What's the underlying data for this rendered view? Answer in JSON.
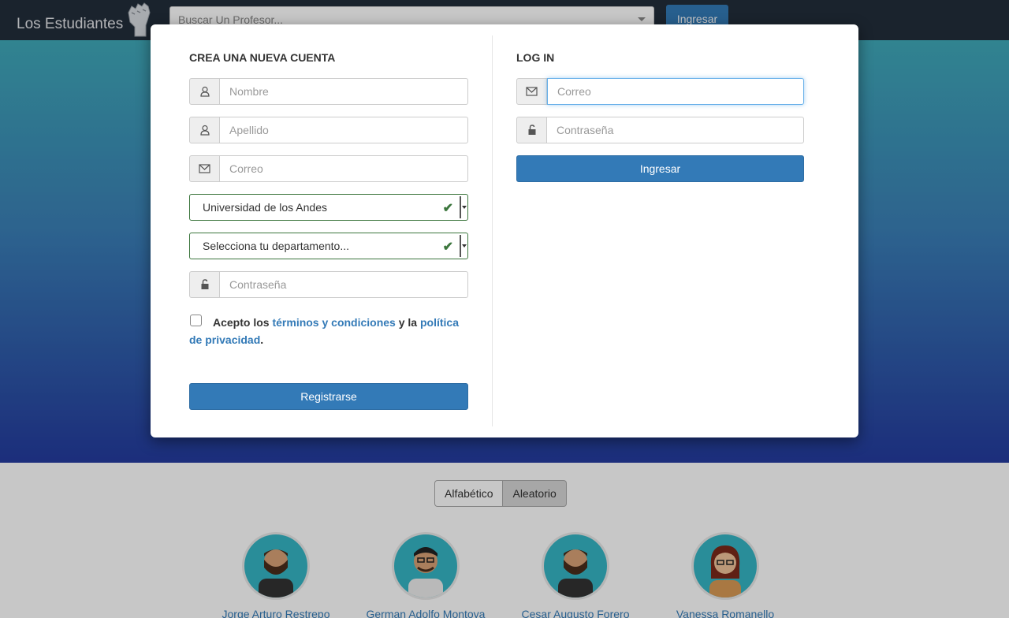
{
  "navbar": {
    "brand": "Los Estudiantes",
    "search_placeholder": "Buscar Un Profesor...",
    "login_button": "Ingresar"
  },
  "sort": {
    "options": [
      "Alfabético",
      "Aleatorio"
    ],
    "selected": "Aleatorio"
  },
  "professors": [
    {
      "name": "Jorge Arturo Restrepo"
    },
    {
      "name": "German Adolfo Montoya"
    },
    {
      "name": "Cesar Augusto Forero"
    },
    {
      "name": "Vanessa Romanello"
    }
  ],
  "signup": {
    "title": "CREA UNA NUEVA CUENTA",
    "first_name_placeholder": "Nombre",
    "last_name_placeholder": "Apellido",
    "email_placeholder": "Correo",
    "university_value": "Universidad de los Andes",
    "department_value": "Selecciona tu departamento...",
    "password_placeholder": "Contraseña",
    "terms_prefix": "Acepto los ",
    "terms_link": "términos y condiciones",
    "terms_middle": " y la ",
    "privacy_link": "política de privacidad",
    "terms_suffix": ".",
    "submit_label": "Registrarse"
  },
  "login": {
    "title": "LOG IN",
    "email_placeholder": "Correo",
    "password_placeholder": "Contraseña",
    "submit_label": "Ingresar"
  },
  "colors": {
    "primary": "#337ab7",
    "success": "#3c763d",
    "navbar": "#222d3a"
  }
}
